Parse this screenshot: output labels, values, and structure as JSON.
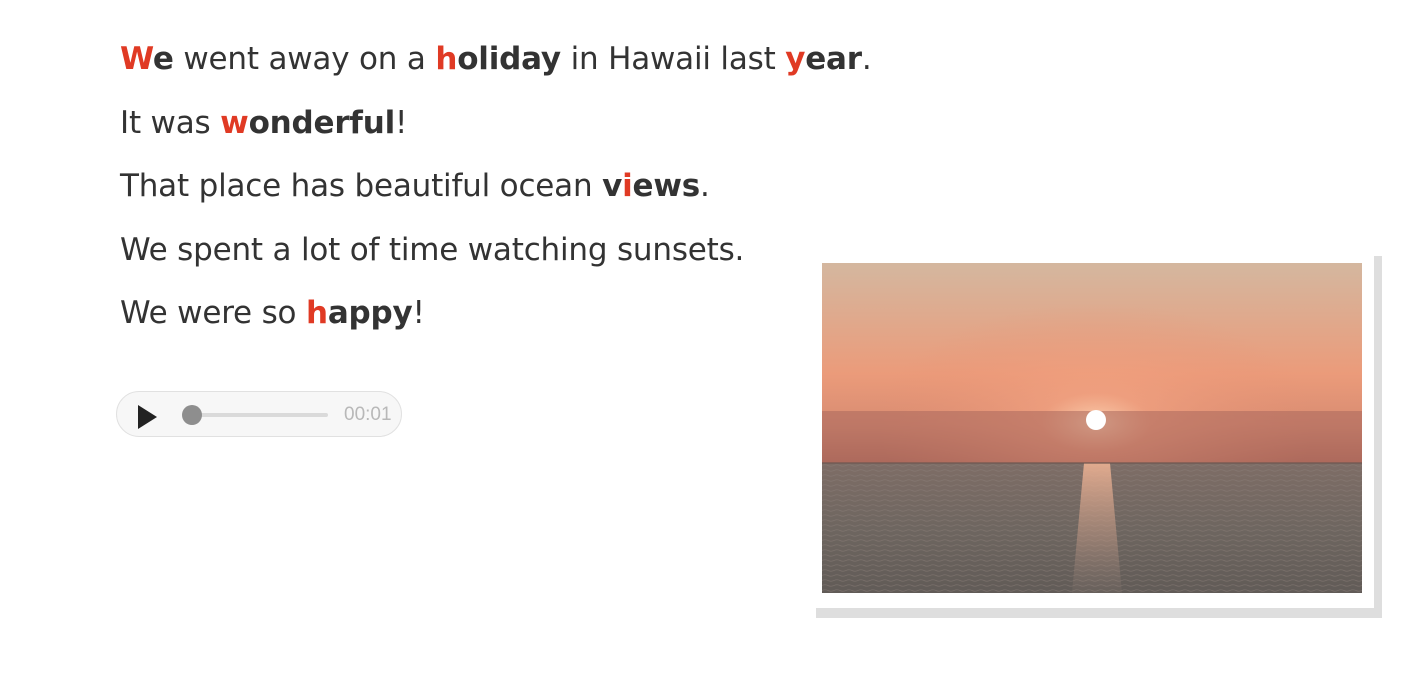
{
  "sentences": [
    {
      "parts": [
        {
          "type": "keyword",
          "first": "W",
          "rest": "e"
        },
        {
          "type": "text",
          "text": " went away on a "
        },
        {
          "type": "keyword",
          "first": "h",
          "rest": "oliday"
        },
        {
          "type": "text",
          "text": " in Hawaii last "
        },
        {
          "type": "keyword",
          "first": "y",
          "rest": "ear"
        },
        {
          "type": "text",
          "text": "."
        }
      ]
    },
    {
      "parts": [
        {
          "type": "text",
          "text": "It was "
        },
        {
          "type": "keyword",
          "first": "w",
          "rest": "onderful"
        },
        {
          "type": "text",
          "text": "!"
        }
      ]
    },
    {
      "parts": [
        {
          "type": "text",
          "text": "That place has beautiful ocean "
        },
        {
          "type": "keyword",
          "before": "v",
          "first": "i",
          "rest": "ews"
        },
        {
          "type": "text",
          "text": "."
        }
      ]
    },
    {
      "parts": [
        {
          "type": "text",
          "text": "We spent a lot of time watching sunsets."
        }
      ]
    },
    {
      "parts": [
        {
          "type": "text",
          "text": "We were so "
        },
        {
          "type": "keyword",
          "first": "h",
          "rest": "appy"
        },
        {
          "type": "text",
          "text": "!"
        }
      ]
    }
  ],
  "audio": {
    "time": "00:01",
    "progress": 0.05,
    "play_icon": "play-icon"
  },
  "image": {
    "subject": "sunset-over-ocean",
    "colors": {
      "sky_top": "#d4b79f",
      "sky_glow": "#eb9b7a",
      "haze": "#b06a5a",
      "sea": "#6e6560",
      "sun": "#ffffff"
    }
  },
  "colors": {
    "text": "#333333",
    "highlight": "#e03a24",
    "time": "#b8b8b8"
  }
}
